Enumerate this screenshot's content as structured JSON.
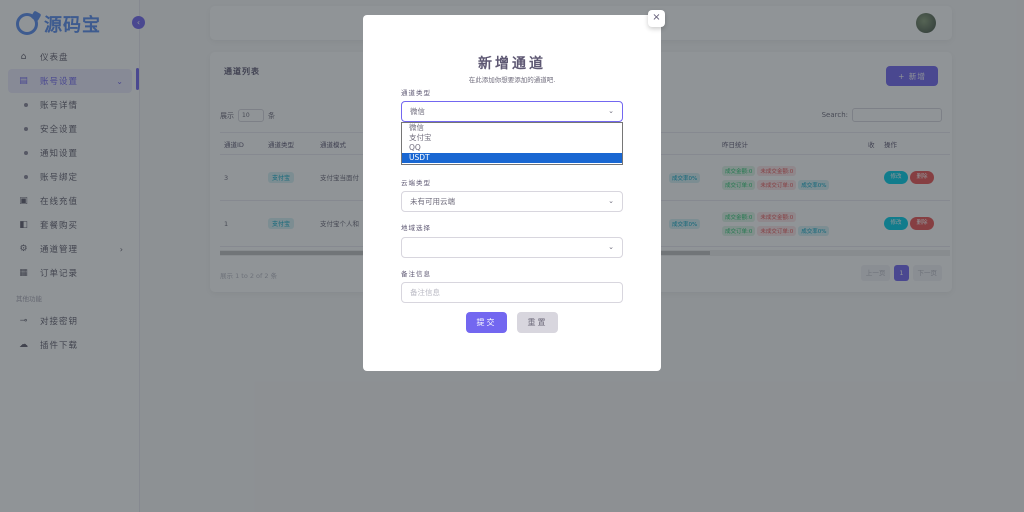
{
  "brand": {
    "name": "源码宝"
  },
  "sidebar": {
    "items": [
      {
        "icon": "home-icon",
        "label": "仪表盘"
      },
      {
        "icon": "user-settings-icon",
        "label": "账号设置"
      },
      {
        "sub": "账号详情"
      },
      {
        "sub": "安全设置"
      },
      {
        "sub": "通知设置"
      },
      {
        "sub": "账号绑定"
      },
      {
        "icon": "wallet-icon",
        "label": "在线充值"
      },
      {
        "icon": "cart-icon",
        "label": "套餐购买"
      },
      {
        "icon": "gear-icon",
        "label": "通道管理"
      },
      {
        "icon": "list-icon",
        "label": "订单记录"
      },
      {
        "section": "其他功能"
      },
      {
        "icon": "key-icon",
        "label": "对接密钥"
      },
      {
        "icon": "cloud-download-icon",
        "label": "插件下载"
      }
    ]
  },
  "card": {
    "title": "通道列表",
    "add_label": "+ 新增",
    "show_prefix": "展示",
    "show_value": "10",
    "show_suffix": "条",
    "search_label": "Search:",
    "columns": [
      "通道ID",
      "通道类型",
      "通道模式",
      "昨日统计",
      "收",
      "操作"
    ],
    "rows": [
      {
        "id": "3",
        "type": "支付宝",
        "mode": "支付宝当面付",
        "s1": "成交金额:0",
        "s2": "未成交金额:0",
        "s3": "成交订单:0",
        "s4": "未成交订单:0",
        "s5": "成交率0%",
        "left_pct": "成交率0%"
      },
      {
        "id": "1",
        "type": "支付宝",
        "mode": "支付宝个人和",
        "s1": "成交金额:0",
        "s2": "未成交金额:0",
        "s3": "成交订单:0",
        "s4": "未成交订单:0",
        "s5": "成交率0%",
        "left_pct": "成交率0%"
      }
    ],
    "edit_label": "修改",
    "del_label": "删除",
    "footer_info": "展示 1 to 2 of 2 条",
    "pager": {
      "prev": "上一页",
      "current": "1",
      "next": "下一页"
    }
  },
  "modal": {
    "close": "×",
    "title": "新增通道",
    "subtitle": "在此添加你想要添加的通道吧.",
    "channel_type_label": "通道类型",
    "channel_type_value": "微信",
    "channel_type_options": [
      "微信",
      "支付宝",
      "QQ",
      "USDT"
    ],
    "channel_type_highlighted": "USDT",
    "cloud_label": "云端类型",
    "cloud_value": "未有可用云端",
    "region_label": "地域选择",
    "region_value": "",
    "remark_label": "备注信息",
    "remark_placeholder": "备注信息",
    "submit_label": "提交",
    "reset_label": "重置"
  }
}
